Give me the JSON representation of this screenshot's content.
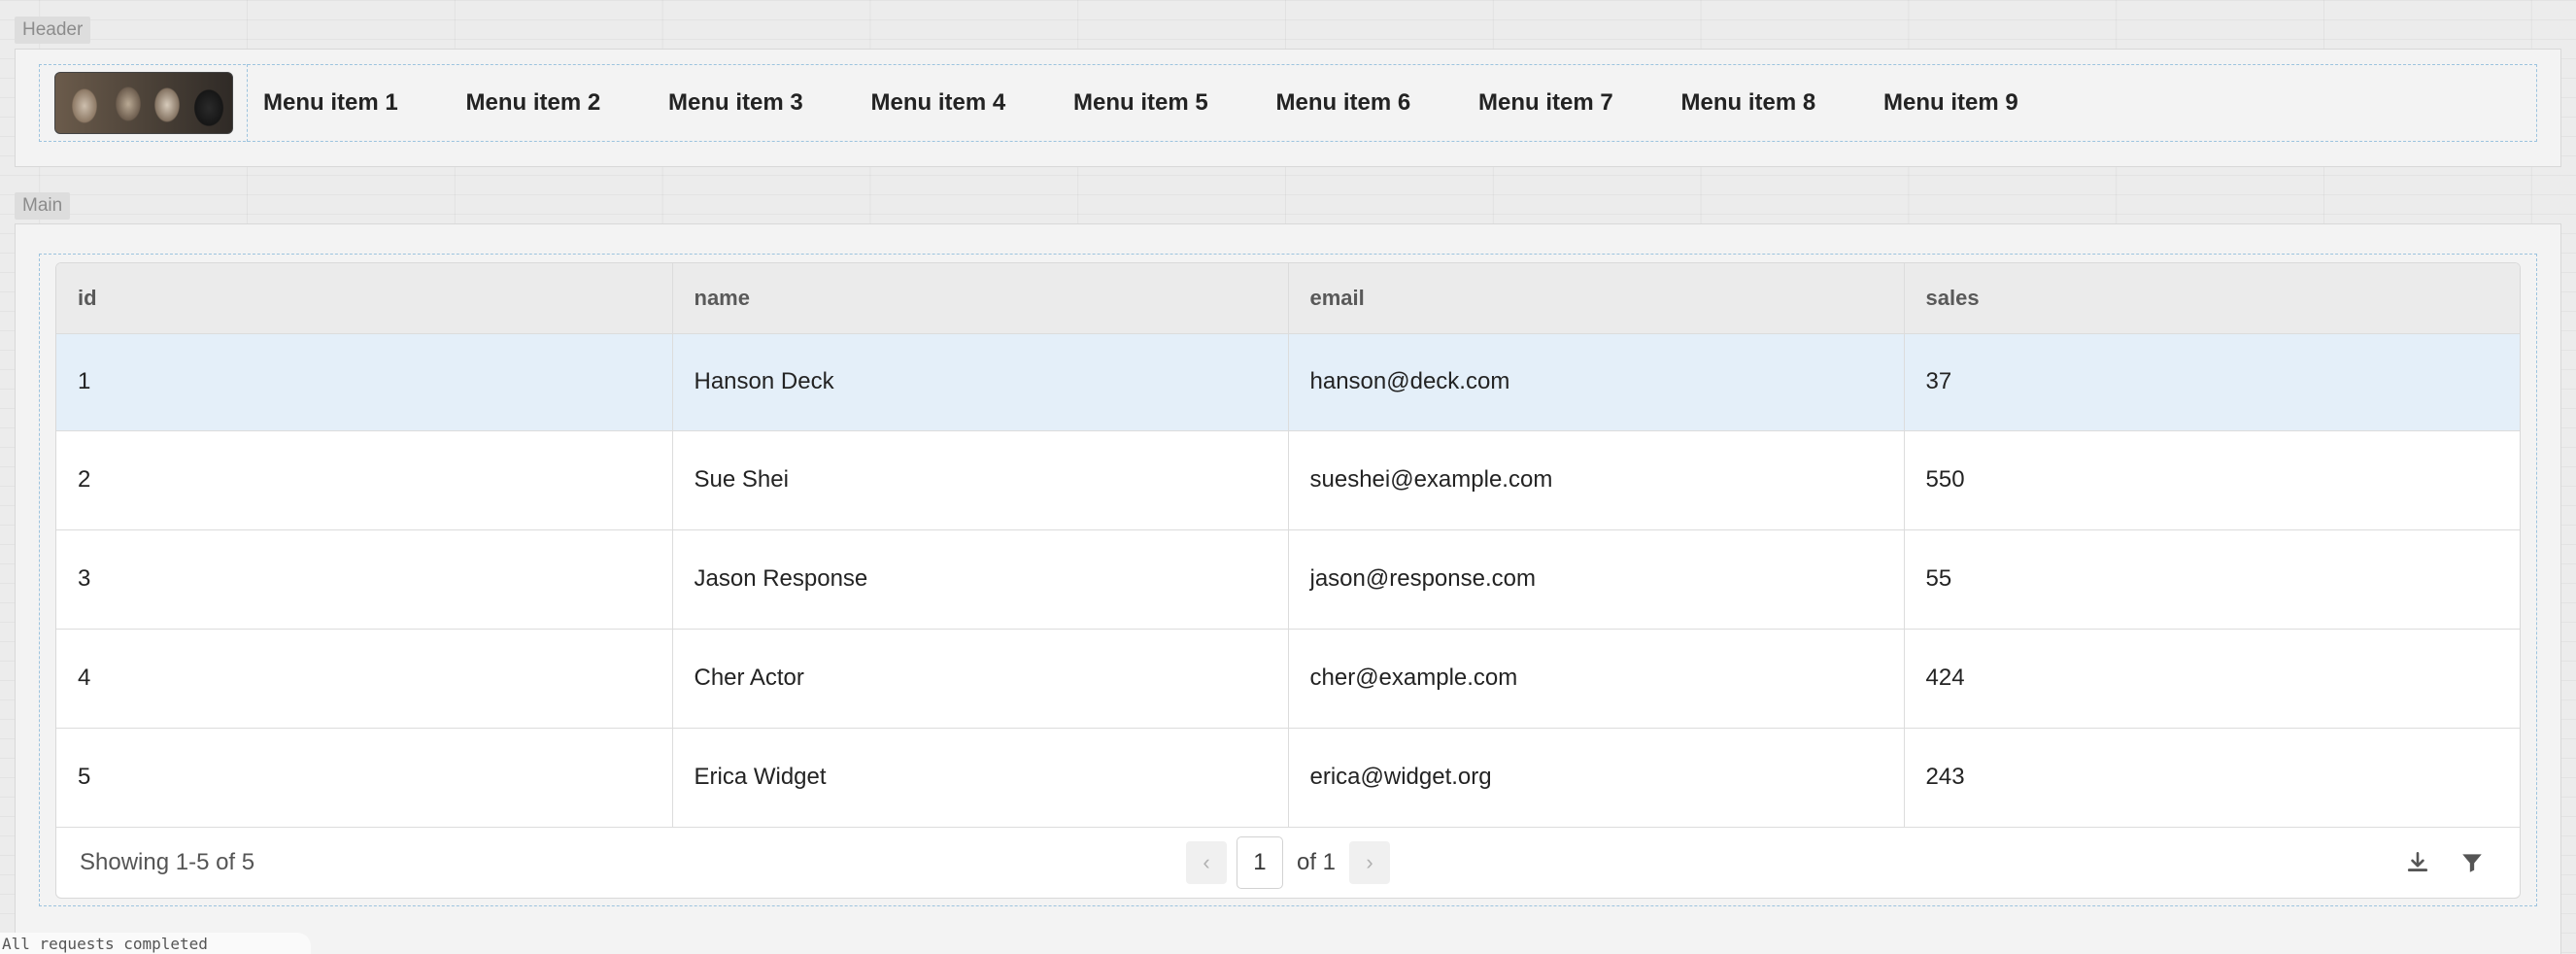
{
  "header": {
    "tag": "Header",
    "logo_icon": "cats-photo-logo",
    "menu": [
      {
        "label": "Menu item 1"
      },
      {
        "label": "Menu item 2"
      },
      {
        "label": "Menu item 3"
      },
      {
        "label": "Menu item 4"
      },
      {
        "label": "Menu item 5"
      },
      {
        "label": "Menu item 6"
      },
      {
        "label": "Menu item 7"
      },
      {
        "label": "Menu item 8"
      },
      {
        "label": "Menu item 9"
      }
    ]
  },
  "main": {
    "tag": "Main",
    "table": {
      "columns": [
        "id",
        "name",
        "email",
        "sales"
      ],
      "rows": [
        [
          "1",
          "Hanson Deck",
          "hanson@deck.com",
          "37"
        ],
        [
          "2",
          "Sue Shei",
          "sueshei@example.com",
          "550"
        ],
        [
          "3",
          "Jason Response",
          "jason@response.com",
          "55"
        ],
        [
          "4",
          "Cher Actor",
          "cher@example.com",
          "424"
        ],
        [
          "5",
          "Erica Widget",
          "erica@widget.org",
          "243"
        ]
      ],
      "selected_row": 1,
      "selected_color": "#e4eff9"
    },
    "footer": {
      "showing": "Showing 1-5 of 5",
      "page": "1",
      "of_pages": "of 1",
      "prev_icon": "chevron-left-icon",
      "next_icon": "chevron-right-icon",
      "download_icon": "download-icon",
      "filter_icon": "filter-icon"
    }
  },
  "bottom_tab": {
    "text": "All requests completed"
  },
  "colors": {
    "accent_dashed": "#9cc3de",
    "page_bg": "#ececec"
  }
}
